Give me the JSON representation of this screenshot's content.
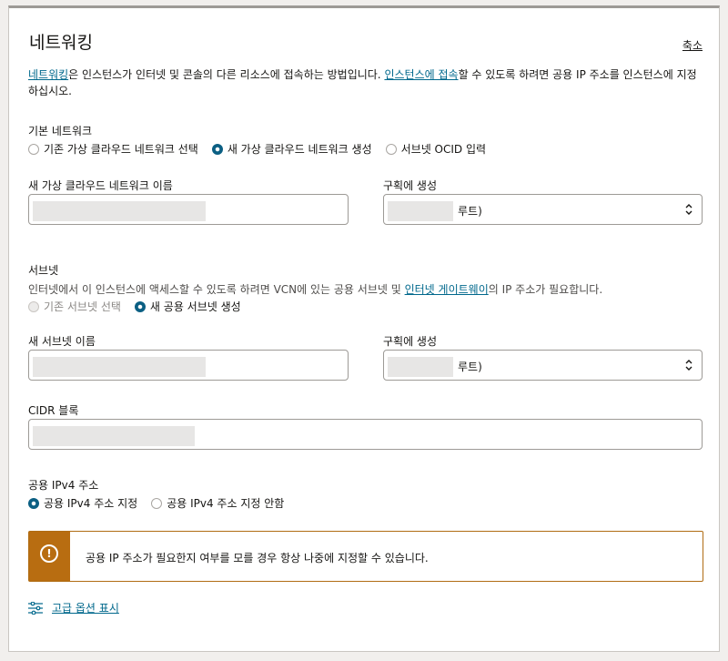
{
  "section": {
    "title": "네트워킹",
    "collapse": "축소"
  },
  "intro": {
    "link1": "네트워킹",
    "text1": "은 인스턴스가 인터넷 및 콘솔의 다른 리소스에 접속하는 방법입니다. ",
    "link2": "인스턴스에 접속",
    "text2": "할 수 있도록 하려면 공용 IP 주소를 인스턴스에 지정하십시오."
  },
  "primary_network": {
    "label": "기본 네트워크",
    "options": [
      "기존 가상 클라우드 네트워크 선택",
      "새 가상 클라우드 네트워크 생성",
      "서브넷 OCID 입력"
    ],
    "selected": "새 가상 클라우드 네트워크 생성",
    "vcn_name_label": "새 가상 클라우드 네트워크 이름",
    "vcn_name_value": "",
    "compartment_label": "구획에 생성",
    "compartment_value": "루트)"
  },
  "subnet": {
    "label": "서브넷",
    "description_pre": "인터넷에서 이 인스턴스에 액세스할 수 있도록 하려면 VCN에 있는 공용 서브넷 및 ",
    "description_link": "인터넷 게이트웨이",
    "description_post": "의 IP 주소가 필요합니다.",
    "options": [
      "기존 서브넷 선택",
      "새 공용 서브넷 생성"
    ],
    "selected": "새 공용 서브넷 생성",
    "name_label": "새 서브넷 이름",
    "name_value": "",
    "compartment_label": "구획에 생성",
    "compartment_value": "루트)",
    "cidr_label": "CIDR 블록",
    "cidr_value": ""
  },
  "public_ip": {
    "label": "공용 IPv4 주소",
    "options": [
      "공용 IPv4 주소 지정",
      "공용 IPv4 주소 지정 안함"
    ],
    "selected": "공용 IPv4 주소 지정"
  },
  "notice": {
    "icon": "warning-icon",
    "text": "공용 IP 주소가 필요한지 여부를 모를 경우 항상 나중에 지정할 수 있습니다."
  },
  "advanced": {
    "icon": "sliders-icon",
    "label": "고급 옵션 표시"
  },
  "colors": {
    "link": "#00688c",
    "warning": "#b86d11",
    "radio_selected": "#0b5f83"
  }
}
